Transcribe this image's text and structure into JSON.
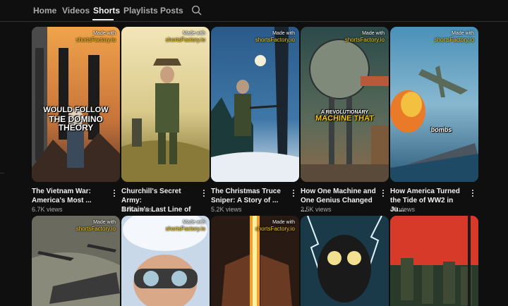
{
  "tabs": [
    {
      "label": "Home",
      "active": false
    },
    {
      "label": "Videos",
      "active": false
    },
    {
      "label": "Shorts",
      "active": true
    },
    {
      "label": "Playlists",
      "active": false
    },
    {
      "label": "Posts",
      "active": false
    }
  ],
  "search_icon": "search-icon",
  "watermark": {
    "line1": "Made with",
    "line2": "shortsFactory.io"
  },
  "shorts": [
    {
      "title_line1": "The Vietnam War:",
      "title_line2": "America's Most ...",
      "views": "6.7K views",
      "caption": [
        "WOULD FOLLOW",
        "THE DOMINO",
        "THEORY"
      ]
    },
    {
      "title_line1": "Churchill's Secret Army:",
      "title_line2": "Britain's Last Line of ...",
      "views": "4.7K views",
      "caption": []
    },
    {
      "title_line1": "The Christmas Truce",
      "title_line2": "Sniper: A Story of ...",
      "views": "5.2K views",
      "caption": []
    },
    {
      "title_line1": "How One Machine and",
      "title_line2": "One Genius Changed ...",
      "views": "2.5K views",
      "caption": [
        "A REVOLUTIONARY",
        "MACHINE THAT"
      ]
    },
    {
      "title_line1": "How America Turned",
      "title_line2": "the Tide of WW2 in Ju...",
      "views": "40 views",
      "caption": [
        "bombs"
      ]
    }
  ],
  "colors": {
    "background": "#0f0f0f",
    "text": "#f1f1f1",
    "secondary": "#aaaaaa",
    "caption_yellow": "#f5c518"
  }
}
